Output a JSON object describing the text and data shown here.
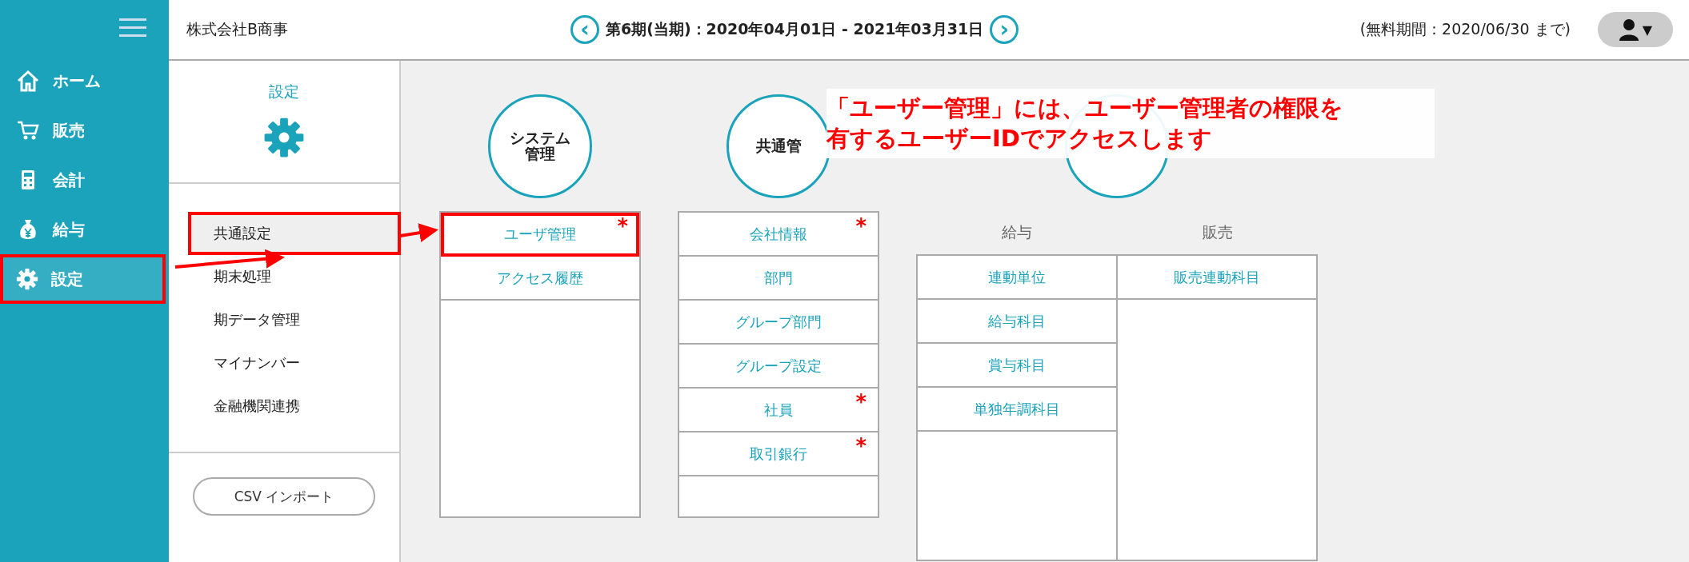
{
  "header": {
    "company": "株式会社B商事",
    "prev_button": "‹",
    "period": "第6期(当期)：2020年04月01日 - 2021年03月31日",
    "next_button": "›",
    "trial": "(無料期間：2020/06/30 まで)",
    "user_menu": "▼"
  },
  "sidebar": {
    "items": [
      {
        "label": "ホーム",
        "selected": false,
        "annotated": false
      },
      {
        "label": "販売",
        "selected": false,
        "annotated": false
      },
      {
        "label": "会計",
        "selected": false,
        "annotated": false
      },
      {
        "label": "給与",
        "selected": false,
        "annotated": false
      },
      {
        "label": "設定",
        "selected": true,
        "annotated": true
      }
    ]
  },
  "submenu": {
    "title": "設定",
    "items": [
      {
        "label": "共通設定",
        "selected": true,
        "annotated": true
      },
      {
        "label": "期末処理",
        "selected": false,
        "annotated": false
      },
      {
        "label": "期データ管理",
        "selected": false,
        "annotated": false
      },
      {
        "label": "マイナンバー",
        "selected": false,
        "annotated": false
      },
      {
        "label": "金融機関連携",
        "selected": false,
        "annotated": false
      }
    ],
    "import_button": "CSV インポート"
  },
  "groups": [
    {
      "circle": [
        "システム",
        "管理"
      ],
      "columns": [
        {
          "items": [
            {
              "label": "ユーザ管理",
              "mark": "*",
              "annotated": true
            },
            {
              "label": "アクセス履歴",
              "annotated": false
            }
          ]
        }
      ]
    },
    {
      "circle": [
        "共通管"
      ],
      "columns": [
        {
          "items": [
            {
              "label": "会社情報",
              "mark": "*",
              "annotated": false
            },
            {
              "label": "部門",
              "annotated": false
            },
            {
              "label": "グループ部門",
              "annotated": false
            },
            {
              "label": "グループ設定",
              "annotated": false
            },
            {
              "label": "社員",
              "mark": "*",
              "annotated": false
            },
            {
              "label": "取引銀行",
              "mark": "*",
              "annotated": false
            }
          ]
        }
      ]
    },
    {
      "columns": [
        {
          "heading": "給与",
          "items": [
            {
              "label": "連動単位",
              "annotated": false
            },
            {
              "label": "給与科目",
              "annotated": false
            },
            {
              "label": "賞与科目",
              "annotated": false
            },
            {
              "label": "単独年調科目",
              "annotated": false
            }
          ]
        },
        {
          "heading": "販売",
          "items": [
            {
              "label": "販売連動科目",
              "annotated": false
            }
          ]
        }
      ]
    }
  ],
  "callout": [
    "「ユーザー管理」には、ユーザー管理者の権限を",
    "有するユーザーIDでアクセスします"
  ]
}
